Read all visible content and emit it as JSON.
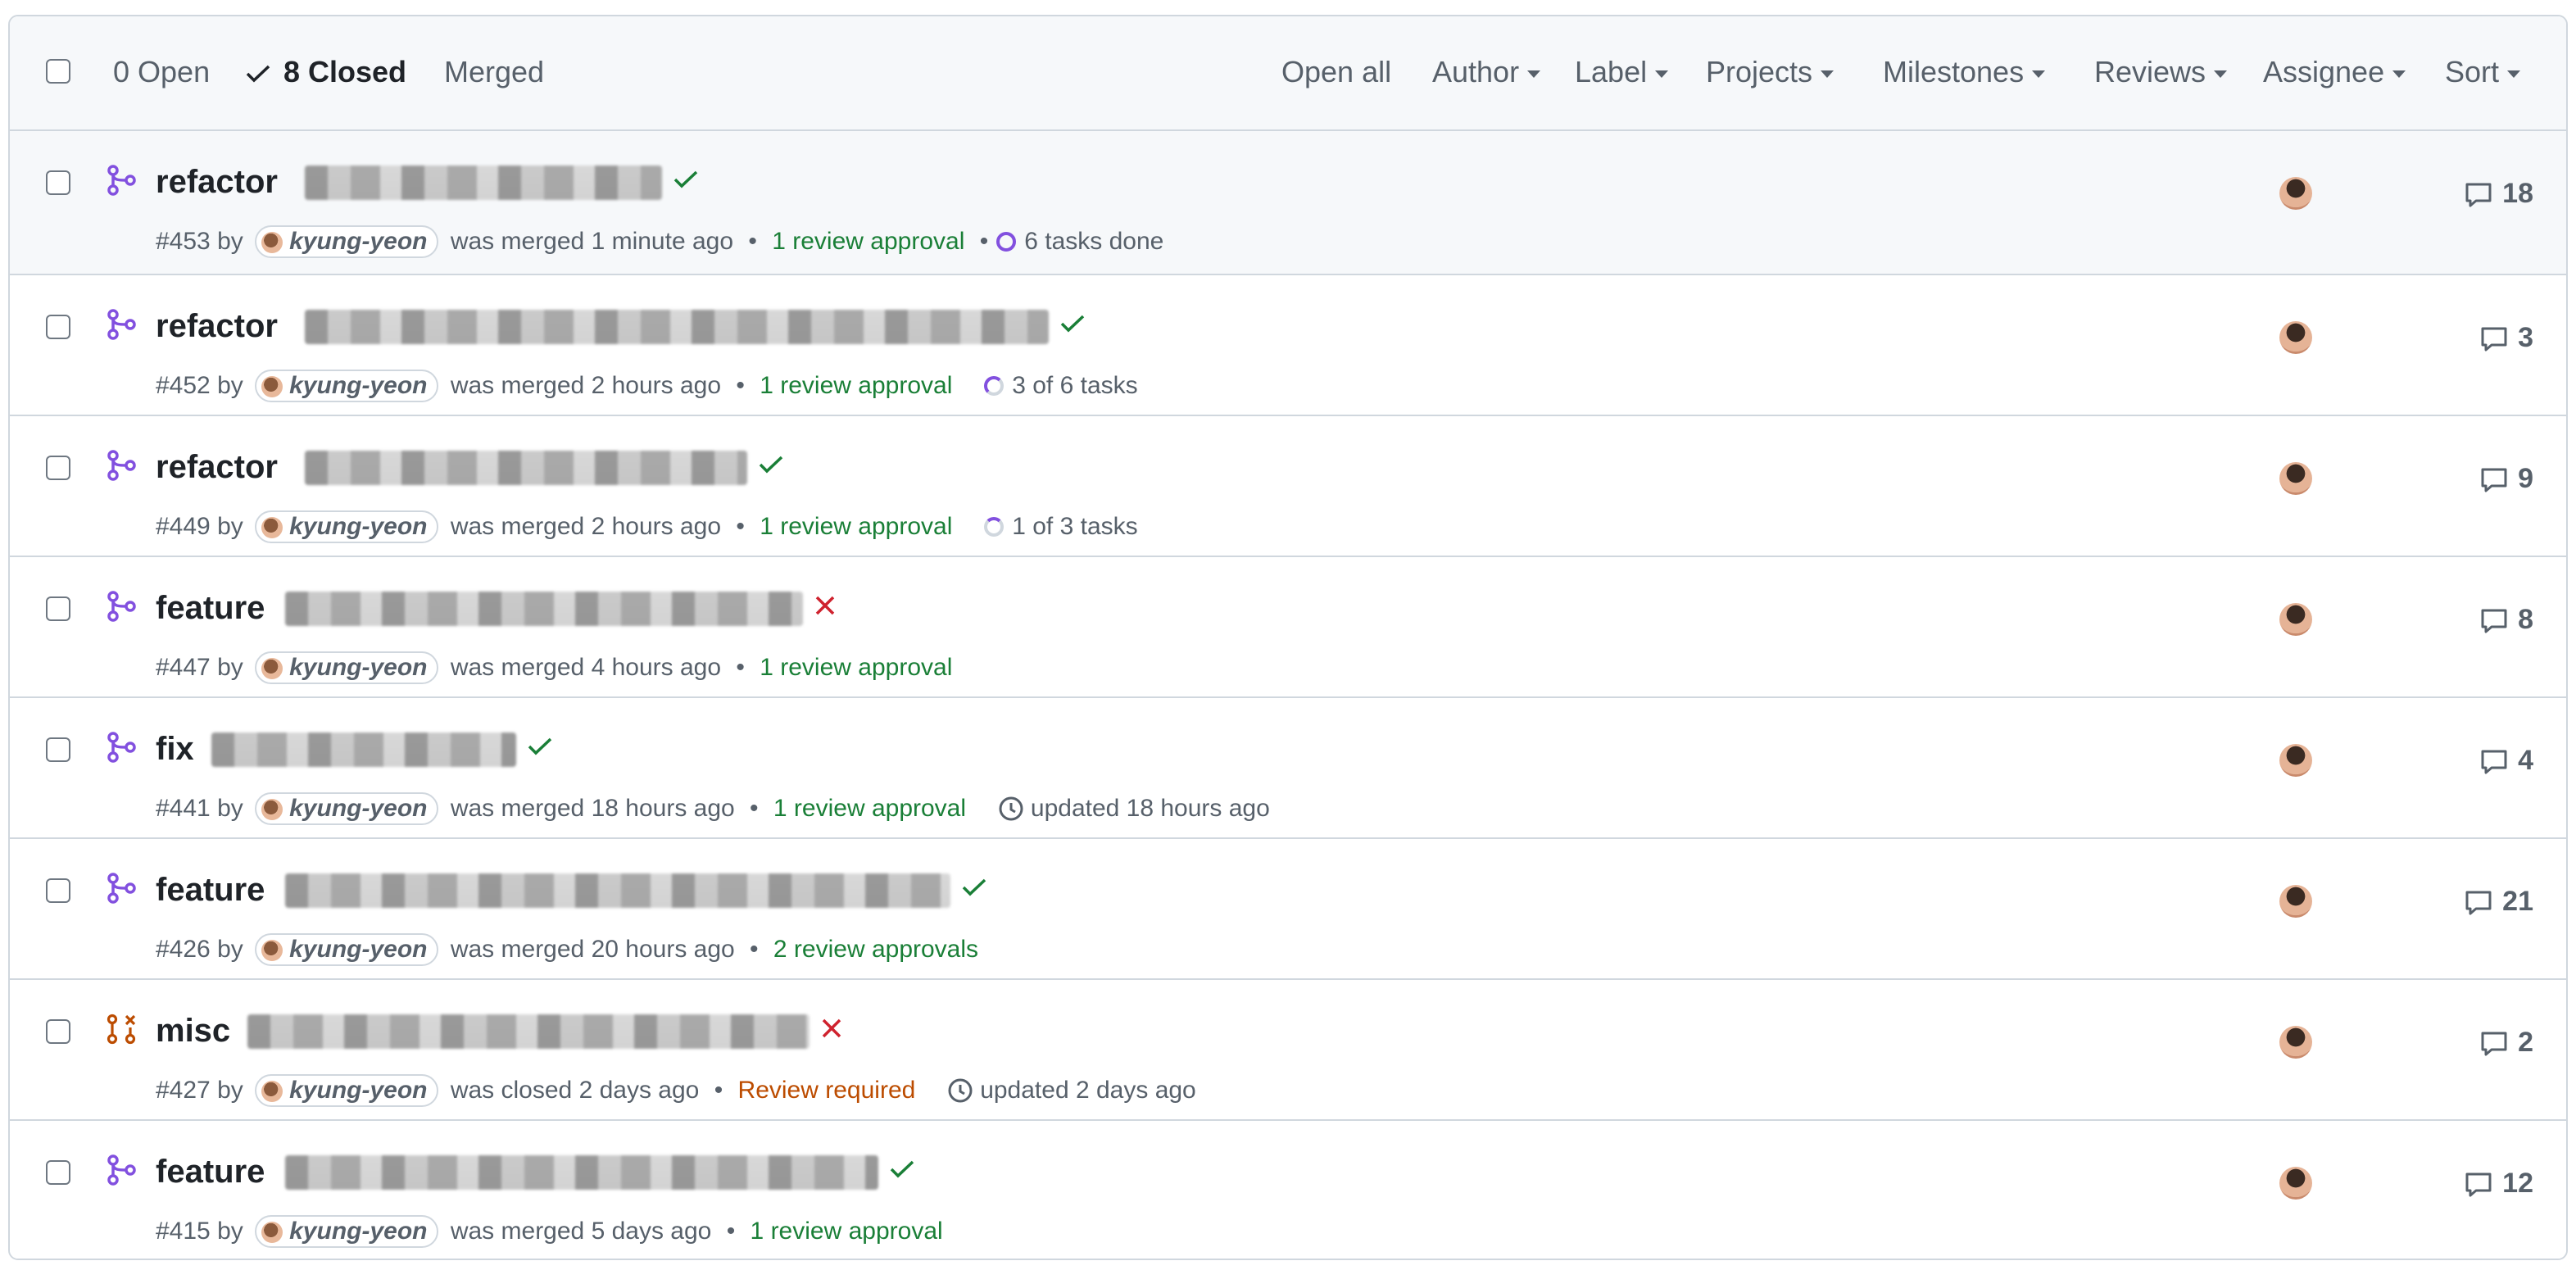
{
  "header": {
    "open_label": "0 Open",
    "closed_label": "8 Closed",
    "merged_label": "Merged",
    "filters": [
      "Open all",
      "Author",
      "Label",
      "Projects",
      "Milestones",
      "Reviews",
      "Assignee",
      "Sort"
    ]
  },
  "rows": [
    {
      "title_prefix": "refactor",
      "status": "success",
      "number": "#453",
      "by": "by",
      "author": "kyung-yeon",
      "state_text": "was merged 1 minute ago",
      "review": "1 review approval",
      "review_kind": "approval",
      "extra_kind": "tasks-done",
      "extra": "6 tasks done",
      "comments": "18"
    },
    {
      "title_prefix": "refactor",
      "status": "success",
      "number": "#452",
      "by": "by",
      "author": "kyung-yeon",
      "state_text": "was merged 2 hours ago",
      "review": "1 review approval",
      "review_kind": "approval",
      "extra_kind": "tasks-partial",
      "extra": "3 of 6 tasks",
      "comments": "3"
    },
    {
      "title_prefix": "refactor",
      "status": "success",
      "number": "#449",
      "by": "by",
      "author": "kyung-yeon",
      "state_text": "was merged 2 hours ago",
      "review": "1 review approval",
      "review_kind": "approval",
      "extra_kind": "tasks-third",
      "extra": "1 of 3 tasks",
      "comments": "9"
    },
    {
      "title_prefix": "feature",
      "status": "failure",
      "number": "#447",
      "by": "by",
      "author": "kyung-yeon",
      "state_text": "was merged 4 hours ago",
      "review": "1 review approval",
      "review_kind": "approval",
      "extra_kind": "none",
      "extra": "",
      "comments": "8"
    },
    {
      "title_prefix": "fix",
      "status": "success",
      "number": "#441",
      "by": "by",
      "author": "kyung-yeon",
      "state_text": "was merged 18 hours ago",
      "review": "1 review approval",
      "review_kind": "approval",
      "extra_kind": "updated",
      "extra": "updated 18 hours ago",
      "comments": "4"
    },
    {
      "title_prefix": "feature",
      "status": "success",
      "number": "#426",
      "by": "by",
      "author": "kyung-yeon",
      "state_text": "was merged 20 hours ago",
      "review": "2 review approvals",
      "review_kind": "approval",
      "extra_kind": "none",
      "extra": "",
      "comments": "21"
    },
    {
      "title_prefix": "misc",
      "status": "failure",
      "number": "#427",
      "by": "by",
      "author": "kyung-yeon",
      "state_text": "was closed 2 days ago",
      "review": "Review required",
      "review_kind": "required",
      "extra_kind": "updated",
      "extra": "updated 2 days ago",
      "comments": "2"
    },
    {
      "title_prefix": "feature",
      "status": "success",
      "number": "#415",
      "by": "by",
      "author": "kyung-yeon",
      "state_text": "was merged 5 days ago",
      "review": "1 review approval",
      "review_kind": "approval",
      "extra_kind": "none",
      "extra": "",
      "comments": "12"
    }
  ],
  "colors": {
    "merged_icon": "#8250df",
    "closed_icon": "#bc4c00",
    "success": "#1a7f37",
    "failure": "#cf222e"
  },
  "icons": {
    "merged": "git-merge-icon",
    "closed": "git-pull-request-closed-icon",
    "comment": "comment-icon",
    "clock": "clock-icon",
    "check": "check-icon",
    "x": "x-icon"
  }
}
